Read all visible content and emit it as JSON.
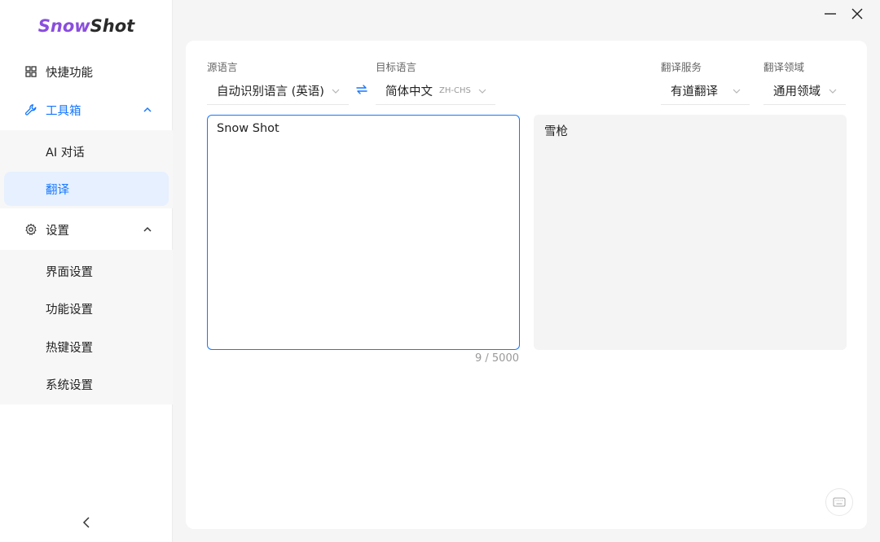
{
  "app": {
    "logo_part1": "Snow",
    "logo_part2": "Shot",
    "brand_color": "#8a4dde",
    "accent_color": "#1677ff"
  },
  "sidebar": {
    "items": [
      {
        "label": "快捷功能",
        "icon": "grid-icon"
      },
      {
        "label": "工具箱",
        "icon": "wrench-icon",
        "expanded": true,
        "children": [
          {
            "label": "AI 对话"
          },
          {
            "label": "翻译",
            "selected": true
          }
        ]
      },
      {
        "label": "设置",
        "icon": "gear-icon",
        "expanded": true,
        "children": [
          {
            "label": "界面设置"
          },
          {
            "label": "功能设置"
          },
          {
            "label": "热键设置"
          },
          {
            "label": "系统设置"
          }
        ]
      }
    ]
  },
  "translate": {
    "source_lang": {
      "label": "源语言",
      "value": "自动识别语言 (英语)"
    },
    "target_lang": {
      "label": "目标语言",
      "value": "简体中文",
      "code": "ZH-CHS"
    },
    "service": {
      "label": "翻译服务",
      "value": "有道翻译"
    },
    "domain": {
      "label": "翻译领域",
      "value": "通用领域"
    },
    "source_text": "Snow Shot",
    "char_count": "9 / 5000",
    "result_text": "雪枪"
  }
}
